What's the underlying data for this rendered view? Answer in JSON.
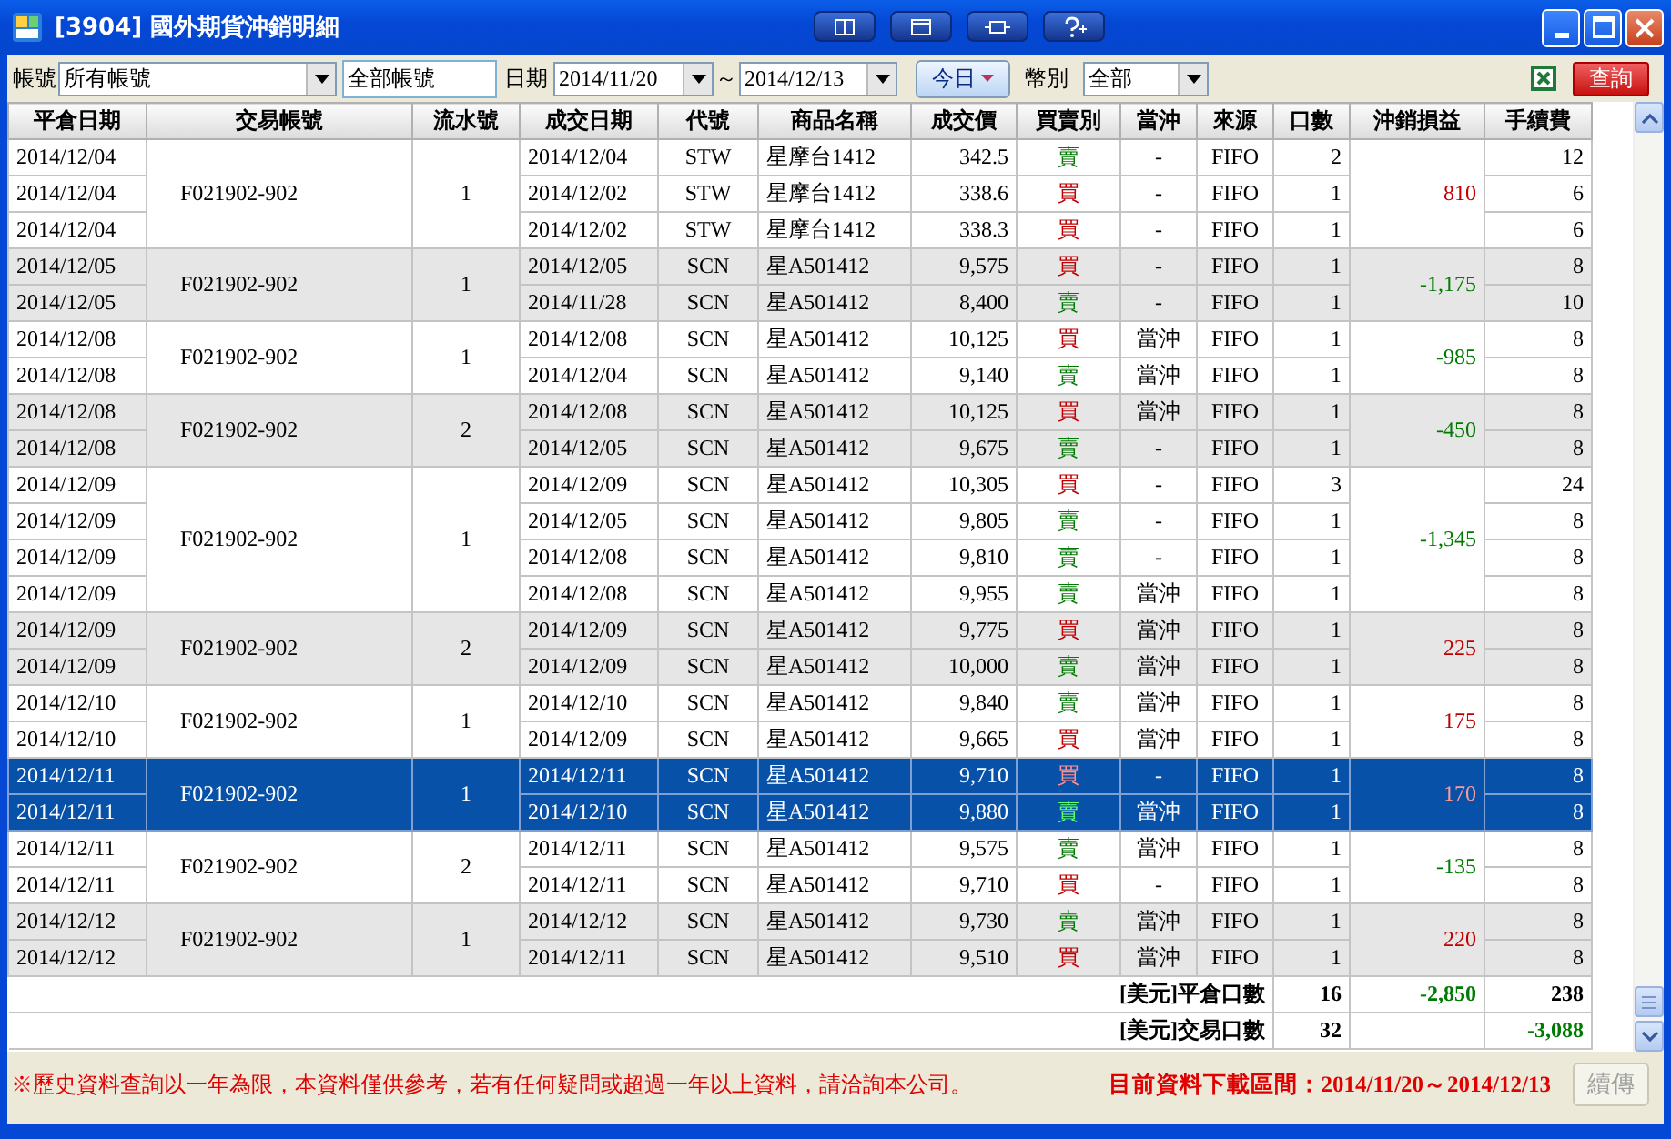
{
  "window": {
    "title": "[3904] 國外期貨沖銷明細"
  },
  "filters": {
    "account_label": "帳號",
    "account": "所有帳號",
    "account_input": "全部帳號",
    "date_label": "日期",
    "date_from": "2014/11/20",
    "date_sep": "～",
    "date_to": "2014/12/13",
    "today_button": "今日",
    "currency_label": "幣別",
    "currency": "全部",
    "query_button": "查詢"
  },
  "columns": [
    "平倉日期",
    "交易帳號",
    "流水號",
    "成交日期",
    "代號",
    "商品名稱",
    "成交價",
    "買賣別",
    "當沖",
    "來源",
    "口數",
    "沖銷損益",
    "手續費"
  ],
  "groups": [
    {
      "account": "F021902-902",
      "serial": "1",
      "pnl": "810",
      "kind": "gain",
      "selected": false,
      "rows": [
        {
          "close_date": "2014/12/04",
          "trade_date": "2014/12/04",
          "code": "STW",
          "product": "星摩台1412",
          "price": "342.5",
          "side": "賣",
          "kind": "sell",
          "day_trade": "-",
          "source": "FIFO",
          "qty": "2",
          "fee": "12"
        },
        {
          "close_date": "2014/12/04",
          "trade_date": "2014/12/02",
          "code": "STW",
          "product": "星摩台1412",
          "price": "338.6",
          "side": "買",
          "kind": "buy",
          "day_trade": "-",
          "source": "FIFO",
          "qty": "1",
          "fee": "6"
        },
        {
          "close_date": "2014/12/04",
          "trade_date": "2014/12/02",
          "code": "STW",
          "product": "星摩台1412",
          "price": "338.3",
          "side": "買",
          "kind": "buy",
          "day_trade": "-",
          "source": "FIFO",
          "qty": "1",
          "fee": "6"
        }
      ]
    },
    {
      "account": "F021902-902",
      "serial": "1",
      "pnl": "-1,175",
      "kind": "loss",
      "selected": false,
      "rows": [
        {
          "close_date": "2014/12/05",
          "trade_date": "2014/12/05",
          "code": "SCN",
          "product": "星A501412",
          "price": "9,575",
          "side": "買",
          "kind": "buy",
          "day_trade": "-",
          "source": "FIFO",
          "qty": "1",
          "fee": "8"
        },
        {
          "close_date": "2014/12/05",
          "trade_date": "2014/11/28",
          "code": "SCN",
          "product": "星A501412",
          "price": "8,400",
          "side": "賣",
          "kind": "sell",
          "day_trade": "-",
          "source": "FIFO",
          "qty": "1",
          "fee": "10"
        }
      ]
    },
    {
      "account": "F021902-902",
      "serial": "1",
      "pnl": "-985",
      "kind": "loss",
      "selected": false,
      "rows": [
        {
          "close_date": "2014/12/08",
          "trade_date": "2014/12/08",
          "code": "SCN",
          "product": "星A501412",
          "price": "10,125",
          "side": "買",
          "kind": "buy",
          "day_trade": "當沖",
          "source": "FIFO",
          "qty": "1",
          "fee": "8"
        },
        {
          "close_date": "2014/12/08",
          "trade_date": "2014/12/04",
          "code": "SCN",
          "product": "星A501412",
          "price": "9,140",
          "side": "賣",
          "kind": "sell",
          "day_trade": "當沖",
          "source": "FIFO",
          "qty": "1",
          "fee": "8"
        }
      ]
    },
    {
      "account": "F021902-902",
      "serial": "2",
      "pnl": "-450",
      "kind": "loss",
      "selected": false,
      "rows": [
        {
          "close_date": "2014/12/08",
          "trade_date": "2014/12/08",
          "code": "SCN",
          "product": "星A501412",
          "price": "10,125",
          "side": "買",
          "kind": "buy",
          "day_trade": "當沖",
          "source": "FIFO",
          "qty": "1",
          "fee": "8"
        },
        {
          "close_date": "2014/12/08",
          "trade_date": "2014/12/05",
          "code": "SCN",
          "product": "星A501412",
          "price": "9,675",
          "side": "賣",
          "kind": "sell",
          "day_trade": "-",
          "source": "FIFO",
          "qty": "1",
          "fee": "8"
        }
      ]
    },
    {
      "account": "F021902-902",
      "serial": "1",
      "pnl": "-1,345",
      "kind": "loss",
      "selected": false,
      "rows": [
        {
          "close_date": "2014/12/09",
          "trade_date": "2014/12/09",
          "code": "SCN",
          "product": "星A501412",
          "price": "10,305",
          "side": "買",
          "kind": "buy",
          "day_trade": "-",
          "source": "FIFO",
          "qty": "3",
          "fee": "24"
        },
        {
          "close_date": "2014/12/09",
          "trade_date": "2014/12/05",
          "code": "SCN",
          "product": "星A501412",
          "price": "9,805",
          "side": "賣",
          "kind": "sell",
          "day_trade": "-",
          "source": "FIFO",
          "qty": "1",
          "fee": "8"
        },
        {
          "close_date": "2014/12/09",
          "trade_date": "2014/12/08",
          "code": "SCN",
          "product": "星A501412",
          "price": "9,810",
          "side": "賣",
          "kind": "sell",
          "day_trade": "-",
          "source": "FIFO",
          "qty": "1",
          "fee": "8"
        },
        {
          "close_date": "2014/12/09",
          "trade_date": "2014/12/08",
          "code": "SCN",
          "product": "星A501412",
          "price": "9,955",
          "side": "賣",
          "kind": "sell",
          "day_trade": "當沖",
          "source": "FIFO",
          "qty": "1",
          "fee": "8"
        }
      ]
    },
    {
      "account": "F021902-902",
      "serial": "2",
      "pnl": "225",
      "kind": "gain",
      "selected": false,
      "rows": [
        {
          "close_date": "2014/12/09",
          "trade_date": "2014/12/09",
          "code": "SCN",
          "product": "星A501412",
          "price": "9,775",
          "side": "買",
          "kind": "buy",
          "day_trade": "當沖",
          "source": "FIFO",
          "qty": "1",
          "fee": "8"
        },
        {
          "close_date": "2014/12/09",
          "trade_date": "2014/12/09",
          "code": "SCN",
          "product": "星A501412",
          "price": "10,000",
          "side": "賣",
          "kind": "sell",
          "day_trade": "當沖",
          "source": "FIFO",
          "qty": "1",
          "fee": "8"
        }
      ]
    },
    {
      "account": "F021902-902",
      "serial": "1",
      "pnl": "175",
      "kind": "gain",
      "selected": false,
      "rows": [
        {
          "close_date": "2014/12/10",
          "trade_date": "2014/12/10",
          "code": "SCN",
          "product": "星A501412",
          "price": "9,840",
          "side": "賣",
          "kind": "sell",
          "day_trade": "當沖",
          "source": "FIFO",
          "qty": "1",
          "fee": "8"
        },
        {
          "close_date": "2014/12/10",
          "trade_date": "2014/12/09",
          "code": "SCN",
          "product": "星A501412",
          "price": "9,665",
          "side": "買",
          "kind": "buy",
          "day_trade": "當沖",
          "source": "FIFO",
          "qty": "1",
          "fee": "8"
        }
      ]
    },
    {
      "account": "F021902-902",
      "serial": "1",
      "pnl": "170",
      "kind": "gain",
      "selected": true,
      "rows": [
        {
          "close_date": "2014/12/11",
          "trade_date": "2014/12/11",
          "code": "SCN",
          "product": "星A501412",
          "price": "9,710",
          "side": "買",
          "kind": "buy",
          "day_trade": "-",
          "source": "FIFO",
          "qty": "1",
          "fee": "8"
        },
        {
          "close_date": "2014/12/11",
          "trade_date": "2014/12/10",
          "code": "SCN",
          "product": "星A501412",
          "price": "9,880",
          "side": "賣",
          "kind": "sell",
          "day_trade": "當沖",
          "source": "FIFO",
          "qty": "1",
          "fee": "8"
        }
      ]
    },
    {
      "account": "F021902-902",
      "serial": "2",
      "pnl": "-135",
      "kind": "loss",
      "selected": false,
      "rows": [
        {
          "close_date": "2014/12/11",
          "trade_date": "2014/12/11",
          "code": "SCN",
          "product": "星A501412",
          "price": "9,575",
          "side": "賣",
          "kind": "sell",
          "day_trade": "當沖",
          "source": "FIFO",
          "qty": "1",
          "fee": "8"
        },
        {
          "close_date": "2014/12/11",
          "trade_date": "2014/12/11",
          "code": "SCN",
          "product": "星A501412",
          "price": "9,710",
          "side": "買",
          "kind": "buy",
          "day_trade": "-",
          "source": "FIFO",
          "qty": "1",
          "fee": "8"
        }
      ]
    },
    {
      "account": "F021902-902",
      "serial": "1",
      "pnl": "220",
      "kind": "gain",
      "selected": false,
      "rows": [
        {
          "close_date": "2014/12/12",
          "trade_date": "2014/12/12",
          "code": "SCN",
          "product": "星A501412",
          "price": "9,730",
          "side": "賣",
          "kind": "sell",
          "day_trade": "當沖",
          "source": "FIFO",
          "qty": "1",
          "fee": "8"
        },
        {
          "close_date": "2014/12/12",
          "trade_date": "2014/12/11",
          "code": "SCN",
          "product": "星A501412",
          "price": "9,510",
          "side": "買",
          "kind": "buy",
          "day_trade": "當沖",
          "source": "FIFO",
          "qty": "1",
          "fee": "8"
        }
      ]
    }
  ],
  "totals": [
    {
      "label": "[美元]平倉口數",
      "qty": "16",
      "pnl": {
        "text": "-2,850",
        "kind": "loss"
      },
      "fee": {
        "text": "238",
        "kind": "plain"
      }
    },
    {
      "label": "[美元]交易口數",
      "qty": "32",
      "fee": {
        "text": "-3,088",
        "kind": "loss"
      }
    }
  ],
  "footer": {
    "notice": "※歷史資料查詢以一年為限，本資料僅供參考，若有任何疑問或超過一年以上資料，請洽詢本公司。",
    "range": "目前資料下載區間：2014/11/20～2014/12/13",
    "resume_button": "續傳",
    "resume_disabled": true
  }
}
